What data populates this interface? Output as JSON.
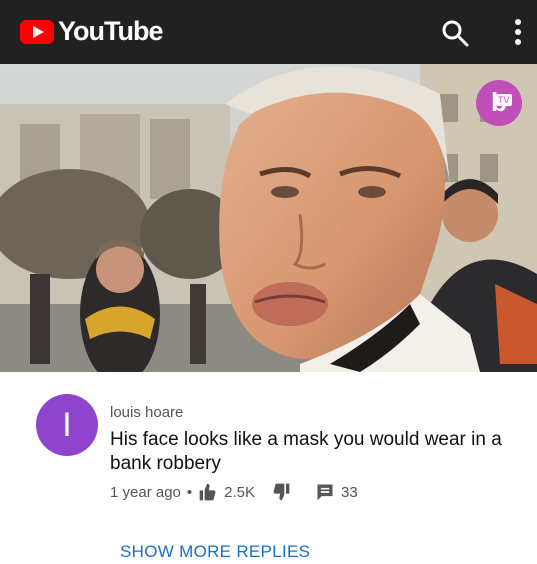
{
  "header": {
    "app_title": "YouTube",
    "search_icon": "search-icon",
    "more_icon": "more-vertical-icon"
  },
  "video": {
    "channel_badge": "b",
    "channel_badge_tv": "TV"
  },
  "comment": {
    "avatar_letter": "I",
    "author": "louis hoare",
    "text": "His face looks like a mask you would wear in a bank robbery",
    "time": "1 year ago",
    "separator": "•",
    "likes": "2.5K",
    "replies_count": "33"
  },
  "show_more_label": "SHOW MORE REPLIES",
  "colors": {
    "topbar": "#212121",
    "brand_red": "#ff0000",
    "avatar": "#8e44cc",
    "link": "#1a6fc1"
  }
}
